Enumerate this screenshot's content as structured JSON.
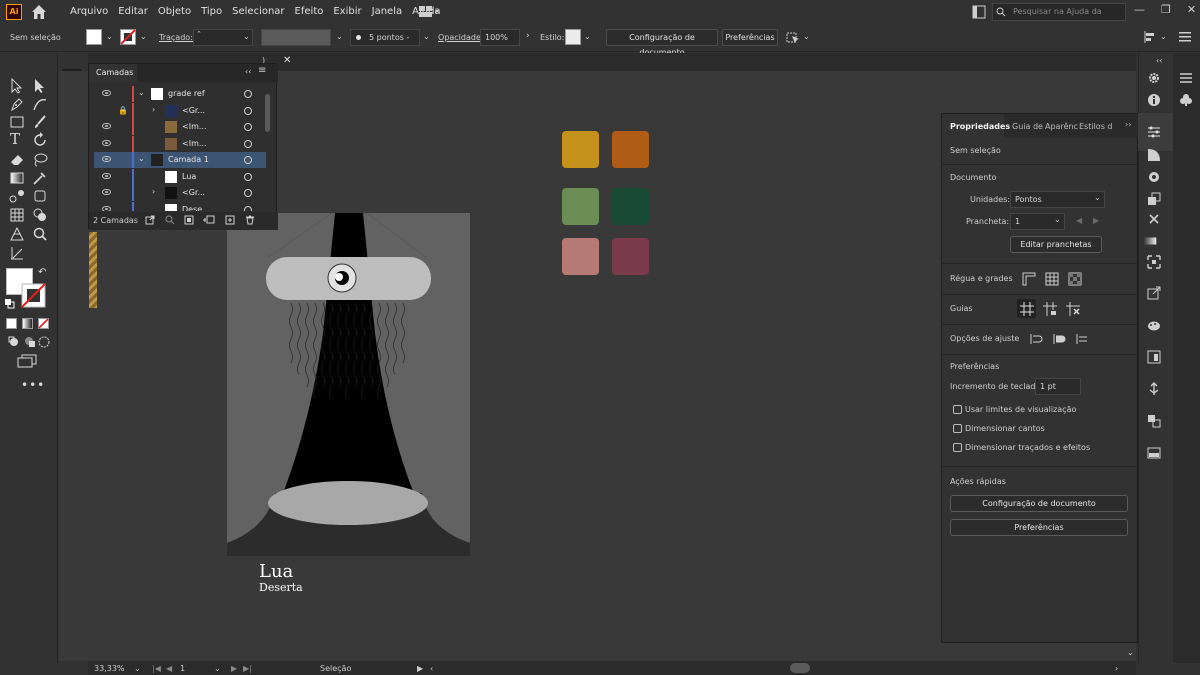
{
  "menubar": {
    "logo": "Ai",
    "items": [
      "Arquivo",
      "Editar",
      "Objeto",
      "Tipo",
      "Selecionar",
      "Efeito",
      "Exibir",
      "Janela",
      "Ajuda"
    ],
    "help_search_placeholder": "Pesquisar na Ajuda da Adobe",
    "window_buttons": [
      "—",
      "❐",
      "✕"
    ]
  },
  "controlbar": {
    "selection": "Sem seleção",
    "stroke_label": "Traçado:",
    "brush": "5 pontos - ...",
    "opacity_label": "Opacidade:",
    "opacity_value": "100%",
    "style_label": "Estilo:",
    "doc_config_button": "Configuração de documento",
    "prefs_button": "Preferências"
  },
  "tab": {
    "name_fragment": ")",
    "close": "✕"
  },
  "layers_panel": {
    "title": "Camadas",
    "footer_count": "2 Camadas",
    "rows": [
      {
        "name": "grade ref",
        "bar": "#d04848",
        "level": 0
      },
      {
        "name": "<Gr...",
        "bar": "#d04848",
        "level": 1
      },
      {
        "name": "<Im...",
        "bar": "#d04848",
        "level": 1
      },
      {
        "name": "<Im...",
        "bar": "#d04848",
        "level": 1
      },
      {
        "name": "Camada 1",
        "bar": "#4a6fd0",
        "level": 0
      },
      {
        "name": "Lua",
        "bar": "#4a6fd0",
        "level": 1
      },
      {
        "name": "<Gr...",
        "bar": "#4a6fd0",
        "level": 1
      },
      {
        "name": "Dese...",
        "bar": "#4a6fd0",
        "level": 1
      }
    ]
  },
  "artwork": {
    "title": "Lua",
    "subtitle": "Deserta"
  },
  "swatches": {
    "colors": [
      "#c4911a",
      "#b05c17",
      "#6c8c55",
      "#184a35",
      "#b57a74",
      "#7a3c4d"
    ]
  },
  "properties_panel": {
    "tabs": [
      "Propriedades",
      "Guia de",
      "Aparênc",
      "Estilos d"
    ],
    "selection": "Sem seleção",
    "document_section": "Documento",
    "units_label": "Unidades:",
    "units_value": "Pontos",
    "artboard_label": "Prancheta:",
    "artboard_value": "1",
    "edit_artboards_button": "Editar pranchetas",
    "rulers_label": "Régua e grades",
    "guides_label": "Guias",
    "snap_label": "Opções de ajuste",
    "prefs_section": "Preferências",
    "keyboard_inc_label": "Incremento de teclado:",
    "keyboard_inc_value": "1 pt",
    "check1": "Usar limites de visualização",
    "check2": "Dimensionar cantos",
    "check3": "Dimensionar traçados e efeitos",
    "quick_actions": "Ações rápidas",
    "doc_config_button": "Configuração de documento",
    "prefs_button": "Preferências"
  },
  "statusbar": {
    "zoom": "33,33%",
    "artboard_num": "1",
    "tool": "Seleção"
  }
}
